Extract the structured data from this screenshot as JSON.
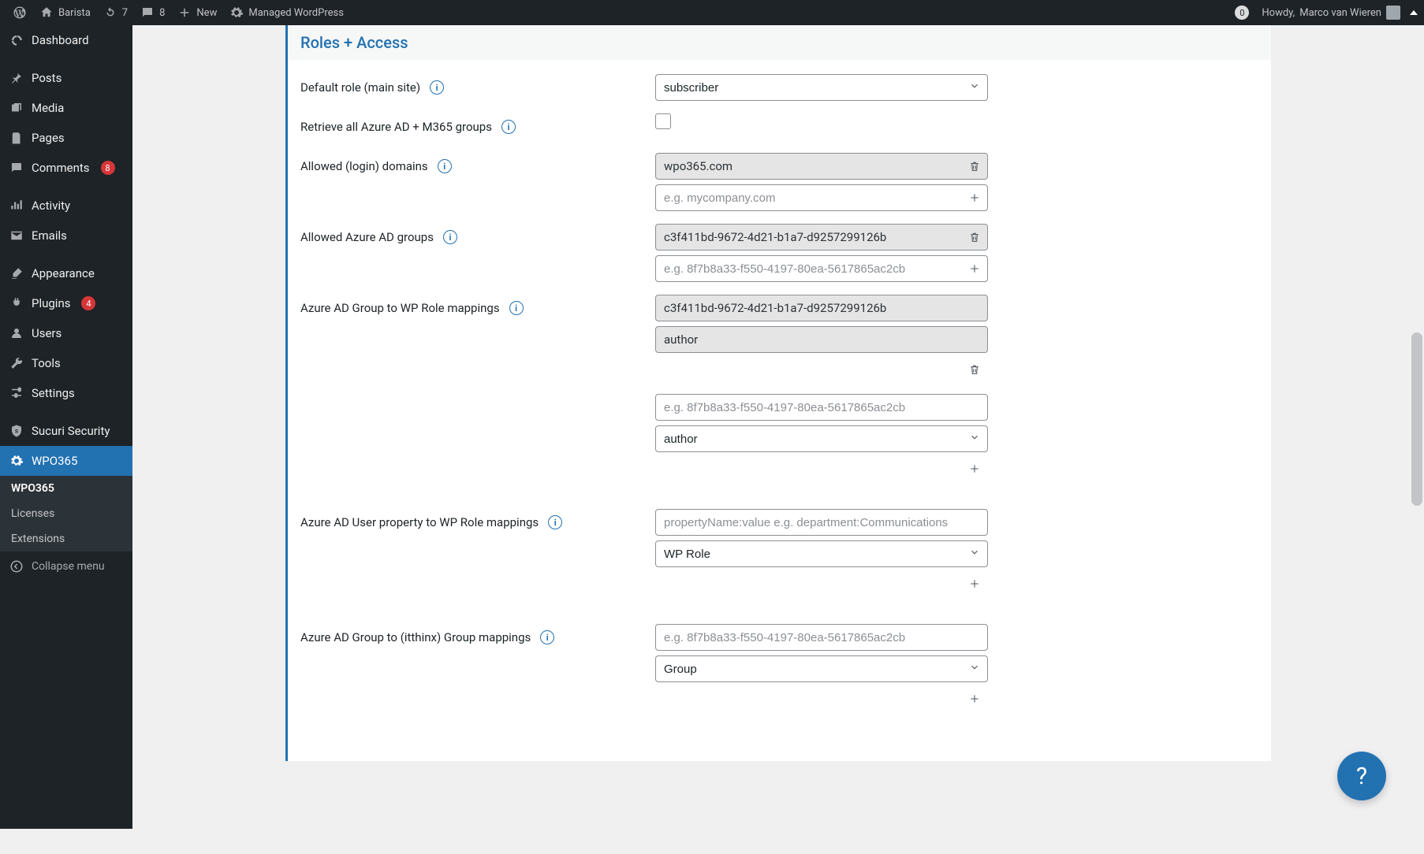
{
  "adminbar": {
    "site_name": "Barista",
    "updates_count": "7",
    "comments_count": "8",
    "new_label": "New",
    "managed_wp_label": "Managed WordPress",
    "right_badge": "0",
    "howdy_prefix": "Howdy, ",
    "user_name": "Marco van Wieren"
  },
  "menu": {
    "dashboard": "Dashboard",
    "posts": "Posts",
    "media": "Media",
    "pages": "Pages",
    "comments": "Comments",
    "comments_count": "8",
    "activity": "Activity",
    "emails": "Emails",
    "appearance": "Appearance",
    "plugins": "Plugins",
    "plugins_count": "4",
    "users": "Users",
    "tools": "Tools",
    "settings": "Settings",
    "sucuri": "Sucuri Security",
    "wpo365": "WPO365",
    "sub_wpo365": "WPO365",
    "sub_licenses": "Licenses",
    "sub_extensions": "Extensions",
    "collapse": "Collapse menu"
  },
  "section": {
    "title": "Roles + Access",
    "default_role_label": "Default role (main site)",
    "default_role_value": "subscriber",
    "retrieve_groups_label": "Retrieve all Azure AD + M365 groups",
    "allowed_domains_label": "Allowed (login) domains",
    "allowed_domains_value": "wpo365.com",
    "allowed_domains_placeholder": "e.g. mycompany.com",
    "allowed_groups_label": "Allowed Azure AD groups",
    "allowed_groups_value": "c3f411bd-9672-4d21-b1a7-d9257299126b",
    "allowed_groups_placeholder": "e.g. 8f7b8a33-f550-4197-80ea-5617865ac2cb",
    "group_role_map_label": "Azure AD Group to WP Role mappings",
    "group_role_map_group": "c3f411bd-9672-4d21-b1a7-d9257299126b",
    "group_role_map_role": "author",
    "group_role_map_placeholder": "e.g. 8f7b8a33-f550-4197-80ea-5617865ac2cb",
    "group_role_map_select": "author",
    "user_prop_map_label": "Azure AD User property to WP Role mappings",
    "user_prop_map_placeholder": "propertyName:value e.g. department:Communications",
    "user_prop_map_select": "WP Role",
    "itthinx_label": "Azure AD Group to (itthinx) Group mappings",
    "itthinx_placeholder": "e.g. 8f7b8a33-f550-4197-80ea-5617865ac2cb",
    "itthinx_select": "Group"
  },
  "help_fab": "?"
}
